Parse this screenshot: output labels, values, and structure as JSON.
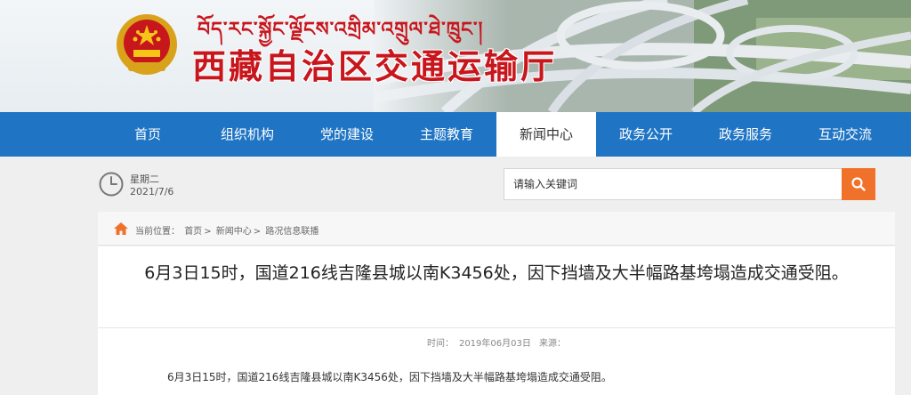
{
  "header": {
    "tibetan_name": "བོད་རང་སྐྱོང་ལྗོངས་འགྲིམ་འགྲུལ་ཐེ་ཁྲུང་།",
    "site_name": "西藏自治区交通运输厅"
  },
  "nav": {
    "items": [
      {
        "label": "首页"
      },
      {
        "label": "组织机构"
      },
      {
        "label": "党的建设"
      },
      {
        "label": "主题教育"
      },
      {
        "label": "新闻中心"
      },
      {
        "label": "政务公开"
      },
      {
        "label": "政务服务"
      },
      {
        "label": "互动交流"
      }
    ],
    "active_index": 4
  },
  "infobar": {
    "weekday": "星期二",
    "date": "2021/7/6",
    "search_placeholder": "请输入关键词",
    "search_button_color": "#f0712a"
  },
  "breadcrumb": {
    "prefix": "当前位置：",
    "items": [
      "首页",
      "新闻中心",
      "路况信息联播"
    ],
    "separator": ">"
  },
  "article": {
    "title": "6月3日15时，国道216线吉隆县城以南K3456处，因下挡墙及大半幅路基垮塌造成交通受阻。",
    "time_label": "时间：",
    "time_value": "2019年06月03日",
    "source_label": "来源：",
    "body": "6月3日15时，国道216线吉隆县城以南K3456处，因下挡墙及大半幅路基垮塌造成交通受阻。"
  },
  "colors": {
    "nav_bg": "#1f74c4",
    "brand_red": "#c8161d",
    "accent_orange": "#f0712a"
  }
}
